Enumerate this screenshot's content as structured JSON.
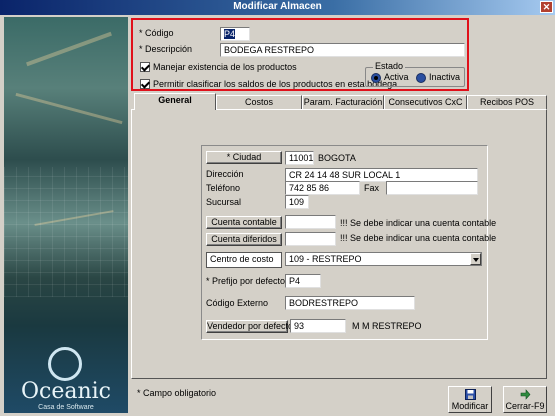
{
  "window": {
    "title": "Modificar Almacen",
    "close_glyph": "✕"
  },
  "header": {
    "codigo_label": "* Código",
    "codigo_value": "P4",
    "descripcion_label": "* Descripción",
    "descripcion_value": "BODEGA RESTREPO",
    "manejar_label": "Manejar existencia de los productos",
    "permitir_label": "Permitir clasificar los saldos de los productos en esta bodega",
    "estado_label": "Estado",
    "activa_label": "Activa",
    "inactiva_label": "Inactiva",
    "estado_selected": "Activa"
  },
  "tabs": [
    {
      "label": "General",
      "active": true
    },
    {
      "label": "Costos"
    },
    {
      "label": "Param. Facturación"
    },
    {
      "label": "Consecutivos CxC"
    },
    {
      "label": "Recibos POS"
    }
  ],
  "general": {
    "ciudad_button": "* Ciudad",
    "ciudad_code": "11001",
    "ciudad_name": "BOGOTA",
    "direccion_label": "Dirección",
    "direccion_value": "CR 24 14 48 SUR LOCAL 1",
    "telefono_label": "Teléfono",
    "telefono_value": "742 85 86",
    "fax_label": "Fax",
    "fax_value": "",
    "sucursal_label": "Sucursal",
    "sucursal_value": "109",
    "cuenta_contable_button": "Cuenta contable",
    "cuenta_contable_value": "",
    "cuenta_contable_warning": "!!! Se debe indicar una cuenta contable",
    "cuenta_diferidos_button": "Cuenta diferidos",
    "cuenta_diferidos_value": "",
    "cuenta_diferidos_warning": "!!! Se debe indicar una cuenta contable",
    "centro_costo_label": "Centro de costo",
    "centro_costo_value": "109 - RESTREPO",
    "prefijo_label": "* Prefijo por defecto",
    "prefijo_value": "P4",
    "codigo_externo_label": "Código Externo",
    "codigo_externo_value": "BODRESTREPO",
    "vendedor_button": "Vendedor por defecto",
    "vendedor_code": "93",
    "vendedor_name": "M M RESTREPO"
  },
  "footer": {
    "note": "* Campo obligatorio",
    "modificar_label": "Modificar",
    "cerrar_label": "Cerrar-F9"
  },
  "logo": {
    "word": "Oceanic",
    "sub": "Casa de Software"
  }
}
